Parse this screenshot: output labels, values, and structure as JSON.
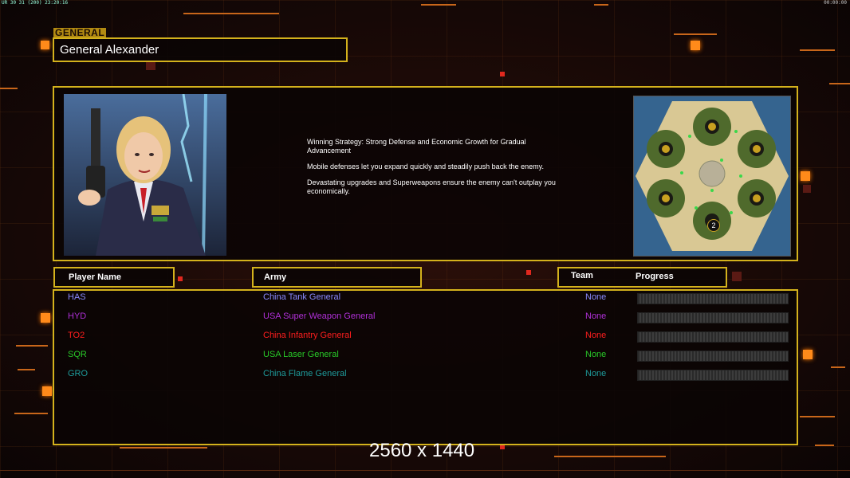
{
  "status_bar": {
    "left": "UR 30 31 (200) 23:20:16",
    "right": "00:00:00"
  },
  "general": {
    "tag": "GENERAL",
    "name": "General Alexander"
  },
  "strategy": {
    "p1": "Winning Strategy: Strong Defense and Economic Growth for Gradual Advancement",
    "p2": "Mobile defenses let you expand quickly and steadily push back the enemy.",
    "p3": "Devastating upgrades and Superweapons ensure the enemy can't outplay you economically."
  },
  "map": {
    "player_marker": "2"
  },
  "headers": {
    "player_name": "Player Name",
    "army": "Army",
    "team": "Team",
    "progress": "Progress"
  },
  "players": [
    {
      "name": "HAS",
      "army": "China Tank General",
      "team": "None",
      "color": "#8a8aff"
    },
    {
      "name": "HYD",
      "army": "USA Super Weapon General",
      "team": "None",
      "color": "#b030d8"
    },
    {
      "name": "TO2",
      "army": "China Infantry General",
      "team": "None",
      "color": "#ff1e1e"
    },
    {
      "name": "SQR",
      "army": "USA Laser General",
      "team": "None",
      "color": "#28c828"
    },
    {
      "name": "GRO",
      "army": "China Flame General",
      "team": "None",
      "color": "#1e9a9a"
    }
  ],
  "resolution_label": "2560 x 1440",
  "colors": {
    "frame": "#d4b21c",
    "accent": "#ff8a1a"
  }
}
